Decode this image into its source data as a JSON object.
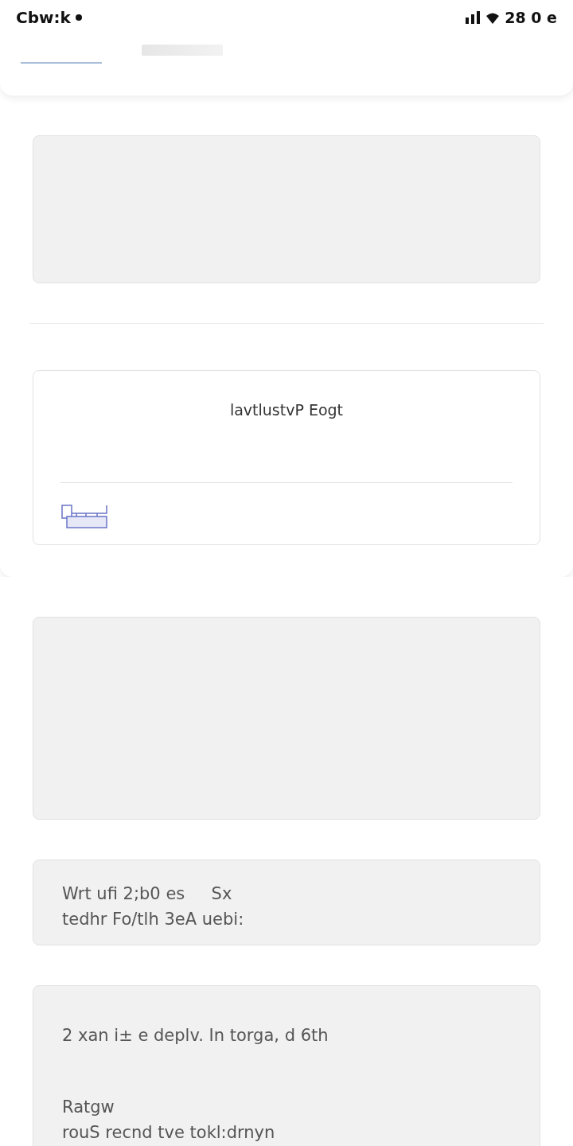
{
  "status_bar": {
    "time": "Cbw:k",
    "right_text": "28 0 e"
  },
  "tabs": [
    {
      "selected": true
    },
    {
      "selected": false
    }
  ],
  "sections": [
    {
      "cards": [
        {
          "kind": "placeholder"
        }
      ]
    },
    {
      "cards": [
        {
          "kind": "titled",
          "title": "lavtlustvP Eogt"
        }
      ]
    },
    {
      "cards": [
        {
          "kind": "placeholder"
        },
        {
          "kind": "text",
          "paragraphs": [
            [
              "Wrt ufi 2;b0 es     Sx",
              "tedhr Fo/tlh 3eA uebi:"
            ]
          ]
        },
        {
          "kind": "text",
          "paragraphs": [
            [
              "2 xan i± e deplv. In torga, d 6th"
            ],
            [
              "Ratgw",
              "rouS recnd tve tokl:drnyn"
            ]
          ]
        }
      ]
    }
  ]
}
